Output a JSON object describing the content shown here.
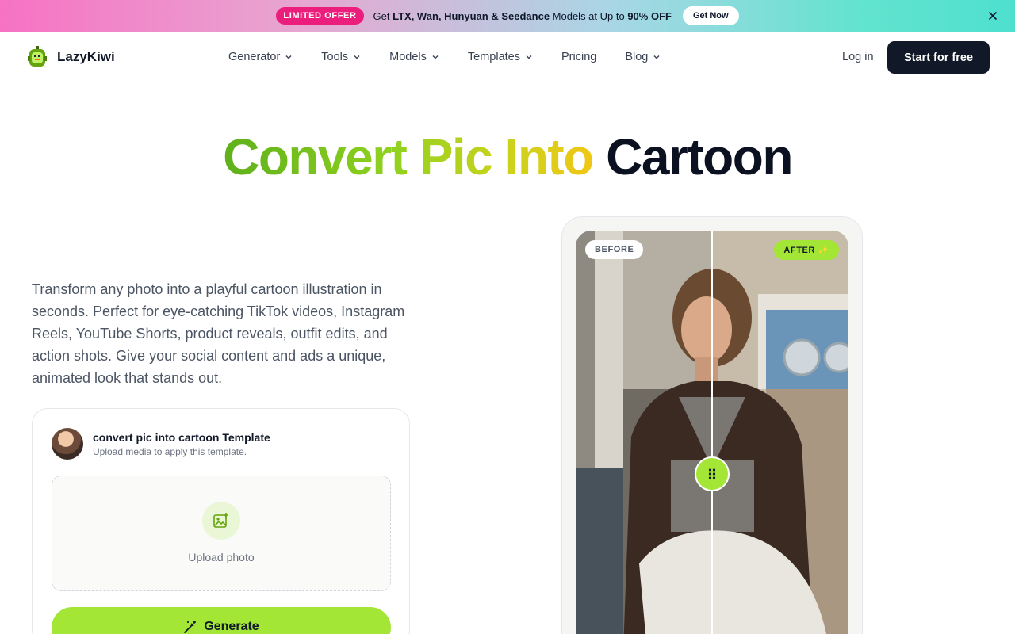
{
  "promo": {
    "badge": "LIMITED OFFER",
    "text_prefix": "Get ",
    "text_bold": "LTX, Wan, Hunyuan & Seedance",
    "text_mid": " Models at Up to ",
    "text_bold2": "90% OFF",
    "button": "Get Now",
    "close_icon": "close-icon"
  },
  "nav": {
    "brand": "LazyKiwi",
    "items": [
      {
        "label": "Generator",
        "dropdown": true
      },
      {
        "label": "Tools",
        "dropdown": true
      },
      {
        "label": "Models",
        "dropdown": true
      },
      {
        "label": "Templates",
        "dropdown": true
      },
      {
        "label": "Pricing",
        "dropdown": false
      },
      {
        "label": "Blog",
        "dropdown": true
      }
    ],
    "login": "Log in",
    "cta": "Start for free"
  },
  "hero": {
    "title_gradient": "Convert Pic Into",
    "title_dark": "Cartoon",
    "description": "Transform any photo into a playful cartoon illustration in seconds. Perfect for eye-catching TikTok videos, Instagram Reels, YouTube Shorts, product reveals, outfit edits, and action shots. Give your social content and ads a unique, animated look that stands out."
  },
  "template_card": {
    "title": "convert pic into cartoon Template",
    "subtitle": "Upload media to apply this template.",
    "upload_label": "Upload photo",
    "generate_label": "Generate"
  },
  "compare": {
    "before_label": "BEFORE",
    "after_label": "AFTER ✨"
  },
  "colors": {
    "accent": "#a3e635",
    "promo_badge": "#ec1e7d",
    "dark": "#111827"
  }
}
